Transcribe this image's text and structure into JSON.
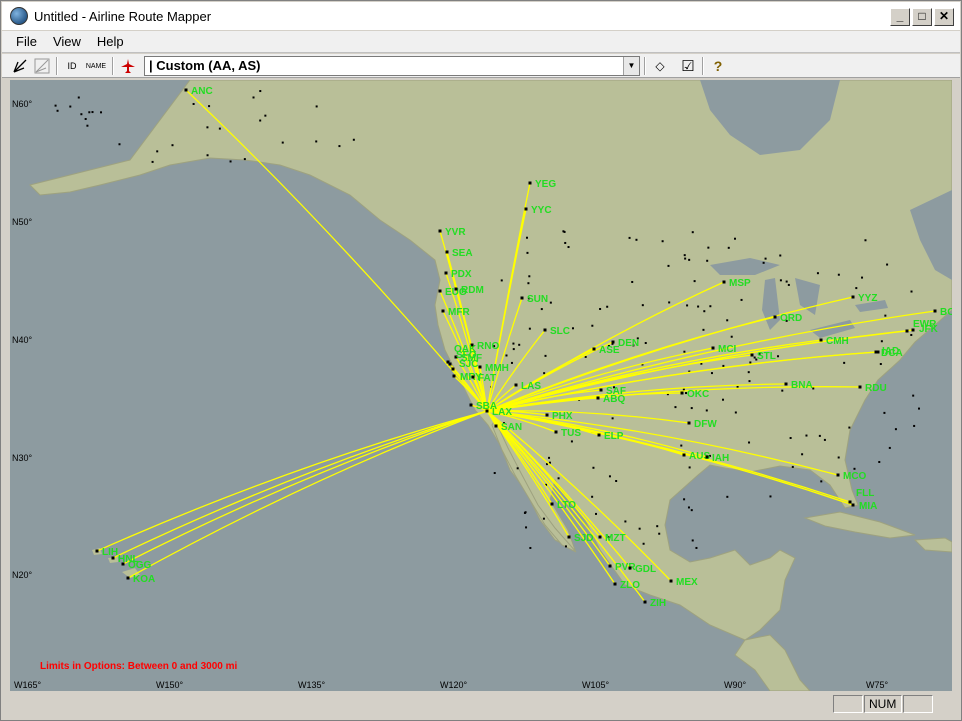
{
  "window": {
    "title": "Untitled - Airline Route Mapper"
  },
  "menu": {
    "file": "File",
    "view": "View",
    "help": "Help"
  },
  "toolbar": {
    "id_label": "ID",
    "name_label": "NAME",
    "combo_value": "| Custom (AA, AS)"
  },
  "map": {
    "limits_note": "Limits in Options: Between 0 and 3000 mi",
    "lat_labels": [
      "N60°",
      "N50°",
      "N40°",
      "N30°",
      "N20°"
    ],
    "lon_labels": [
      "W165°",
      "W150°",
      "W135°",
      "W120°",
      "W105°",
      "W90°",
      "W75°"
    ],
    "colors": {
      "ocean": "#8d9ba0",
      "land": "#b9bf98",
      "route": "#ffff00",
      "label": "#22dd22",
      "note": "#ff0000"
    },
    "hub": "LAX",
    "airports": [
      "ANC",
      "YEG",
      "YYC",
      "YVR",
      "SEA",
      "PDX",
      "EUG",
      "RDM",
      "MFR",
      "SUN",
      "RNO",
      "SLC",
      "SMF",
      "OAK",
      "SFO",
      "SJC",
      "MRY",
      "FAT",
      "MMH",
      "SBA",
      "LAX",
      "SAN",
      "LAS",
      "ASE",
      "DEN",
      "PHX",
      "TUS",
      "SAF",
      "ABQ",
      "ELP",
      "MSP",
      "ORD",
      "YYZ",
      "BOS",
      "EWR",
      "JFK",
      "CMH",
      "MCI",
      "STL",
      "DCA",
      "IAD",
      "BNA",
      "RDU",
      "OKC",
      "DFW",
      "AUS",
      "IAH",
      "MCO",
      "MIA",
      "FLL",
      "LTO",
      "SJD",
      "MZT",
      "PVR",
      "GDL",
      "ZLO",
      "MEX",
      "ZIH",
      "LIH",
      "HNL",
      "OGG",
      "KOA"
    ]
  },
  "status": {
    "num": "NUM"
  }
}
